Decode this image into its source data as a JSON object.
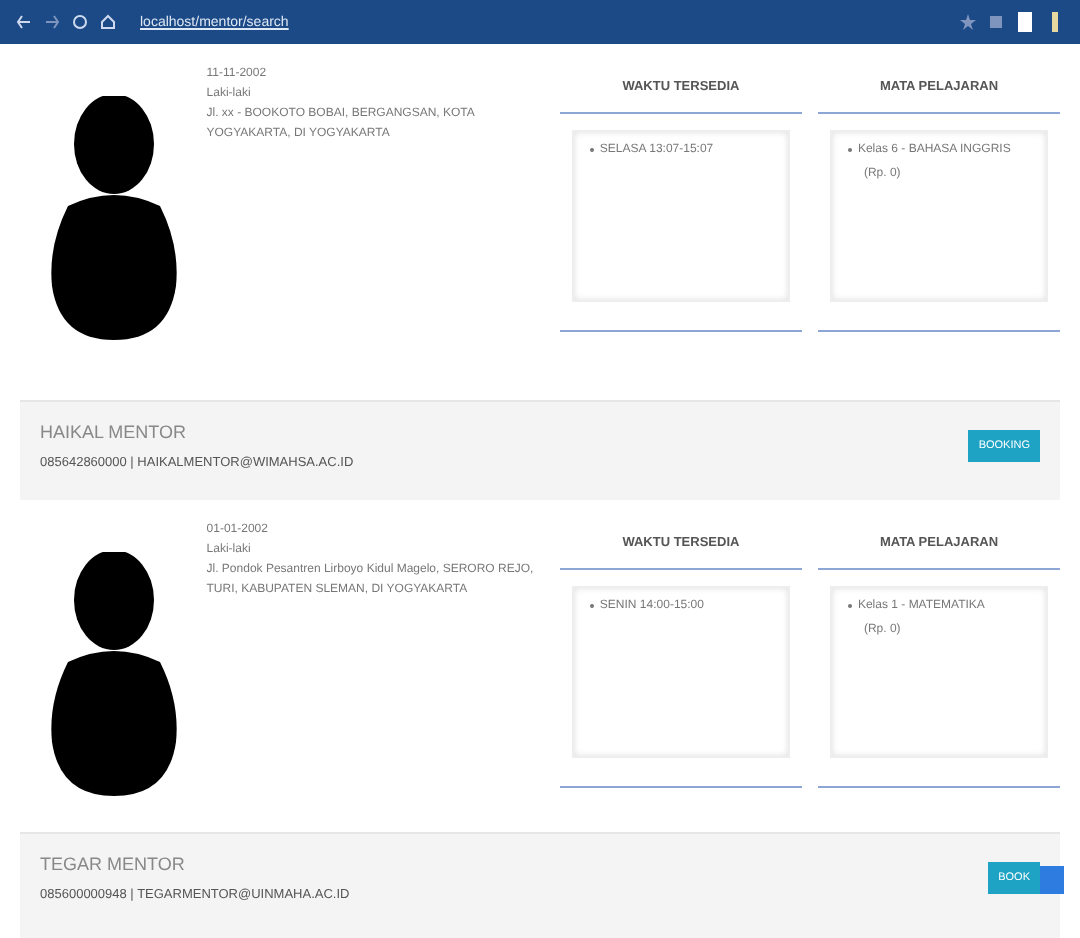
{
  "browser": {
    "url": "localhost/mentor/search"
  },
  "mentors": [
    {
      "details": [
        "11-11-2002",
        "Laki-laki",
        "Jl. xx - BOOKOTO BOBAI, BERGANGSAN, KOTA",
        "YOGYAKARTA, DI YOGYAKARTA"
      ],
      "availability_title": "WAKTU TERSEDIA",
      "availability": [
        {
          "text": "SELASA 13:07-15:07"
        }
      ],
      "subjects_title": "MATA PELAJARAN",
      "subjects": [
        {
          "text": "Kelas 6 - BAHASA INGGRIS",
          "price": "(Rp. 0)"
        }
      ],
      "name": "HAIKAL MENTOR",
      "contact": "085642860000 | HAIKALMENTOR@WIMAHSA.AC.ID",
      "button": "BOOKING"
    },
    {
      "details": [
        "01-01-2002",
        "Laki-laki",
        "Jl. Pondok Pesantren Lirboyo Kidul Magelo, SERORO REJO,",
        "TURI, KABUPATEN SLEMAN, DI YOGYAKARTA"
      ],
      "availability_title": "WAKTU TERSEDIA",
      "availability": [
        {
          "text": "SENIN 14:00-15:00"
        }
      ],
      "subjects_title": "MATA PELAJARAN",
      "subjects": [
        {
          "text": "Kelas 1 - MATEMATIKA",
          "price": "(Rp. 0)"
        }
      ],
      "name": "TEGAR MENTOR",
      "contact": "085600000948 | TEGARMENTOR@UINMAHA.AC.ID",
      "button": "BOOK"
    }
  ]
}
